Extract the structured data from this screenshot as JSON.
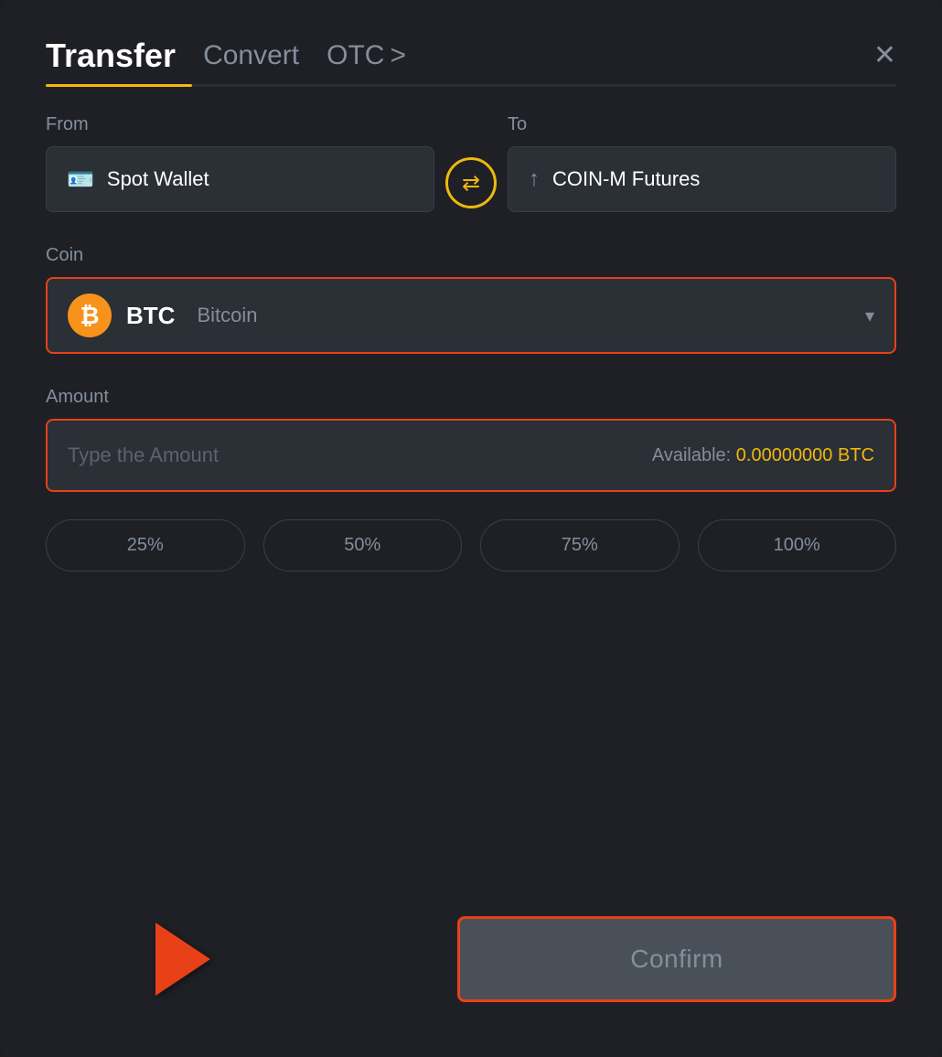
{
  "modal": {
    "title": "Transfer"
  },
  "tabs": {
    "transfer": "Transfer",
    "convert": "Convert",
    "otc": "OTC"
  },
  "from_label": "From",
  "to_label": "To",
  "from_wallet": "Spot Wallet",
  "to_wallet": "COIN-M Futures",
  "coin_label": "Coin",
  "coin_symbol": "BTC",
  "coin_name": "Bitcoin",
  "amount_label": "Amount",
  "amount_placeholder": "Type the Amount",
  "available_label": "Available:",
  "available_value": "0.00000000",
  "available_currency": "BTC",
  "percent_buttons": [
    "25%",
    "50%",
    "75%",
    "100%"
  ],
  "confirm_label": "Confirm",
  "close_label": "✕",
  "otc_chevron": ">",
  "swap_icon": "⇄"
}
